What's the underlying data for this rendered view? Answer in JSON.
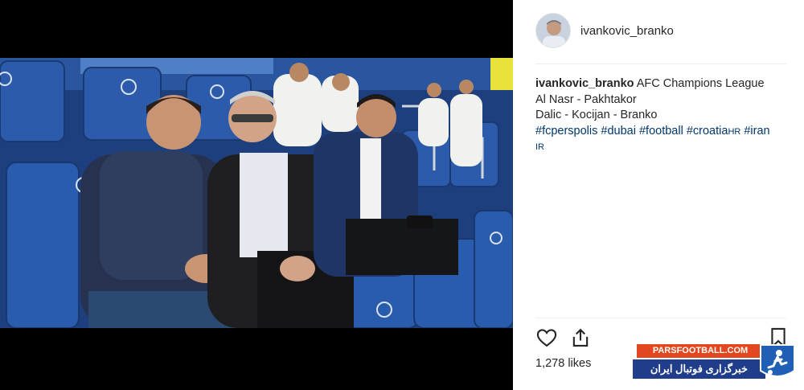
{
  "post": {
    "username": "ivankovic_branko",
    "caption": {
      "author": "ivankovic_branko",
      "line1": "AFC Champions League",
      "line2": "Al Nasr - Pakhtakor",
      "line3": "Dalic - Kocijan - Branko",
      "tags": [
        "#fcperspolis",
        "#dubai",
        "#football",
        "#croatia"
      ],
      "tag_suffix": "HR",
      "tag_last": "#iran",
      "tag_last_suffix": "IR"
    },
    "likes": "1,278 likes"
  },
  "icons": {
    "like": "heart-icon",
    "share": "share-icon",
    "save": "bookmark-icon"
  },
  "watermark": {
    "site": "PARSFOOTBALL.COM",
    "tagline": "خبرگزاری فوتبال ایران"
  },
  "colors": {
    "text": "#262626",
    "hashtag": "#00376b",
    "divider": "#efefef",
    "seat_blue": "#2f5fb0",
    "watermark_orange": "#e2471f",
    "watermark_blue": "#1f3d8a"
  }
}
